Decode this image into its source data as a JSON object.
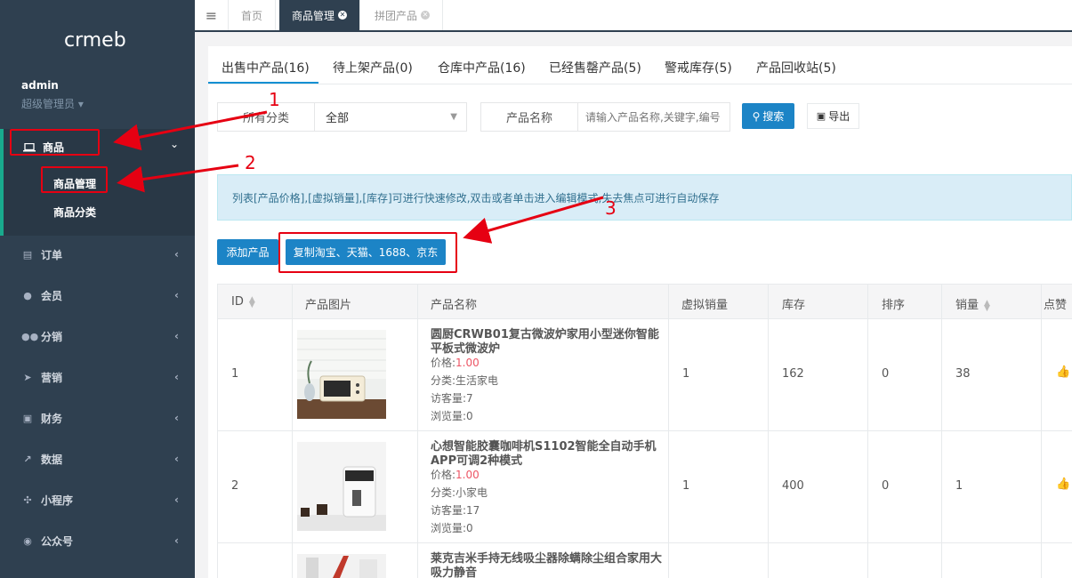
{
  "brand": {
    "logo_text": "crmeb"
  },
  "user": {
    "name": "admin",
    "role": "超级管理员"
  },
  "sidebar": {
    "goods": {
      "label": "商品",
      "sub": [
        "商品管理",
        "商品分类"
      ]
    },
    "items": [
      {
        "label": "订单",
        "icon": "document-icon"
      },
      {
        "label": "会员",
        "icon": "user-icon"
      },
      {
        "label": "分销",
        "icon": "users-icon"
      },
      {
        "label": "营销",
        "icon": "send-icon"
      },
      {
        "label": "财务",
        "icon": "money-icon"
      },
      {
        "label": "数据",
        "icon": "chart-icon"
      },
      {
        "label": "小程序",
        "icon": "miniprogram-icon"
      },
      {
        "label": "公众号",
        "icon": "wechat-icon"
      }
    ]
  },
  "topbar": {
    "tabs": [
      "首页",
      "商品管理",
      "拼团产品"
    ]
  },
  "product_tabs": [
    "出售中产品(16)",
    "待上架产品(0)",
    "仓库中产品(16)",
    "已经售罄产品(5)",
    "警戒库存(5)",
    "产品回收站(5)"
  ],
  "filter": {
    "category_label": "所有分类",
    "category_value": "全部",
    "name_label": "产品名称",
    "name_placeholder": "请输入产品名称,关键字,编号",
    "search_label": "搜索",
    "export_label": "导出"
  },
  "notice": "列表[产品价格],[虚拟销量],[库存]可进行快速修改,双击或者单击进入编辑模式,失去焦点可进行自动保存",
  "actions": {
    "add": "添加产品",
    "copy": "复制淘宝、天猫、1688、京东"
  },
  "table": {
    "headers": [
      "ID",
      "产品图片",
      "产品名称",
      "虚拟销量",
      "库存",
      "排序",
      "销量",
      "点赞"
    ],
    "rows": [
      {
        "id": "1",
        "name": "圆厨CRWB01复古微波炉家用小型迷你智能平板式微波炉",
        "price_label": "价格:",
        "price": "1.00",
        "category": "分类:生活家电",
        "visitors": "访客量:7",
        "views": "浏览量:0",
        "virtual_sales": "1",
        "stock": "162",
        "sort": "0",
        "sales": "38"
      },
      {
        "id": "2",
        "name": "心想智能胶囊咖啡机S1102智能全自动手机APP可调2种模式",
        "price_label": "价格:",
        "price": "1.00",
        "category": "分类:小家电",
        "visitors": "访客量:17",
        "views": "浏览量:0",
        "virtual_sales": "1",
        "stock": "400",
        "sort": "0",
        "sales": "1"
      },
      {
        "name": "莱克吉米手持无线吸尘器除螨除尘组合家用大吸力静音"
      }
    ]
  },
  "annotations": [
    "1",
    "2",
    "3"
  ],
  "colors": {
    "sidebar": "#2f4050",
    "primary": "#1c84c6",
    "annotation": "#e60012",
    "price": "#ed5565"
  }
}
